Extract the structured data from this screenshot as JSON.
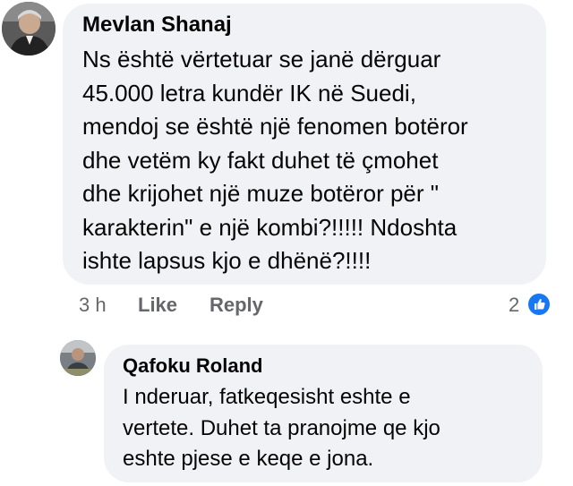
{
  "comment": {
    "author": "Mevlan Shanaj",
    "text": "Ns është vërtetuar se janë dërguar\n45.000 letra kundër IK në Suedi,\nmendoj se është një fenomen botëror\ndhe vetëm ky fakt duhet të çmohet\ndhe krijohet një muze botëror për \"\nkarakterin\" e një kombi?!!!!! Ndoshta\nishte lapsus kjo e dhënë?!!!!",
    "time": "3 h",
    "like_label": "Like",
    "reply_label": "Reply",
    "reaction_count": "2",
    "reaction_icon": "like-icon"
  },
  "reply": {
    "author": "Qafoku Roland",
    "text": "I nderuar, fatkeqesisht eshte e\nvertete. Duhet ta pranojme qe kjo\neshte pjese e keqe e jona."
  },
  "colors": {
    "bubble": "#f0f2f5",
    "meta": "#65676b",
    "like_blue": "#1877f2"
  }
}
